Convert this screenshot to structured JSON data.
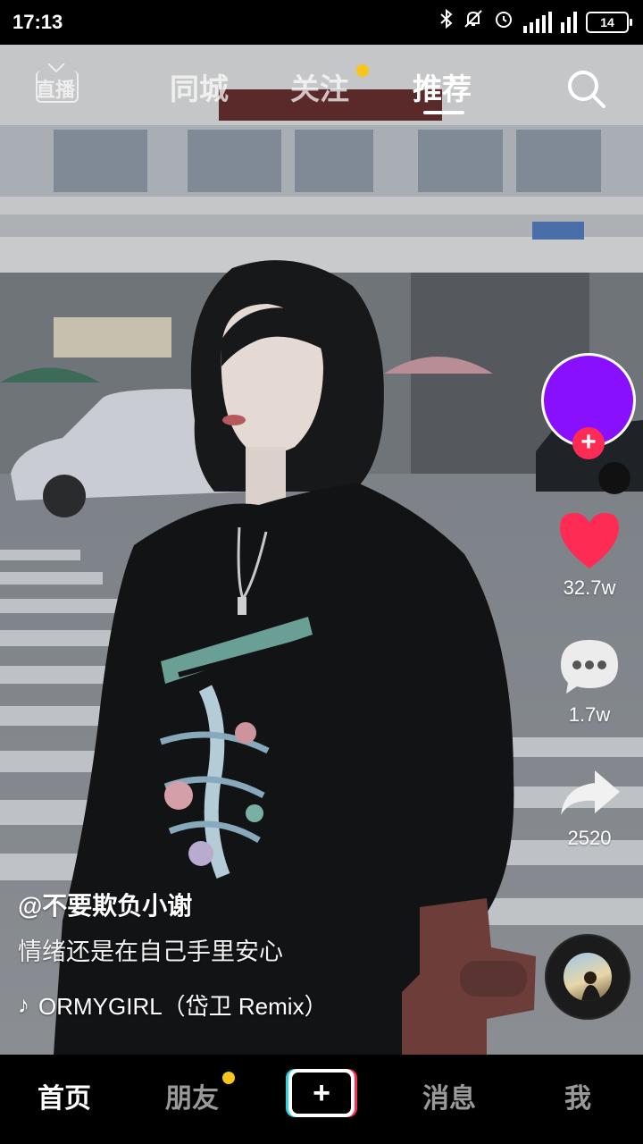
{
  "status_bar": {
    "time": "17:13",
    "battery": "14"
  },
  "top_tabs": {
    "live": "直播",
    "tabs": [
      "同城",
      "关注",
      "推荐"
    ],
    "active_tab": "推荐"
  },
  "creator": {
    "avatar_color": "#8810ff",
    "follow_symbol": "+"
  },
  "actions": {
    "likes": "32.7w",
    "comments": "1.7w",
    "shares": "2520"
  },
  "caption": {
    "author": "@不要欺负小谢",
    "description": "情绪还是在自己手里安心",
    "music": "ORMYGIRL（岱卫 Remix）"
  },
  "bottom_nav": {
    "items": [
      "首页",
      "朋友",
      "消息",
      "我"
    ],
    "create_symbol": "+"
  },
  "colors": {
    "accent_red": "#fe2c55",
    "accent_cyan": "#2cd3e1",
    "notify_yellow": "#f9c51a"
  }
}
